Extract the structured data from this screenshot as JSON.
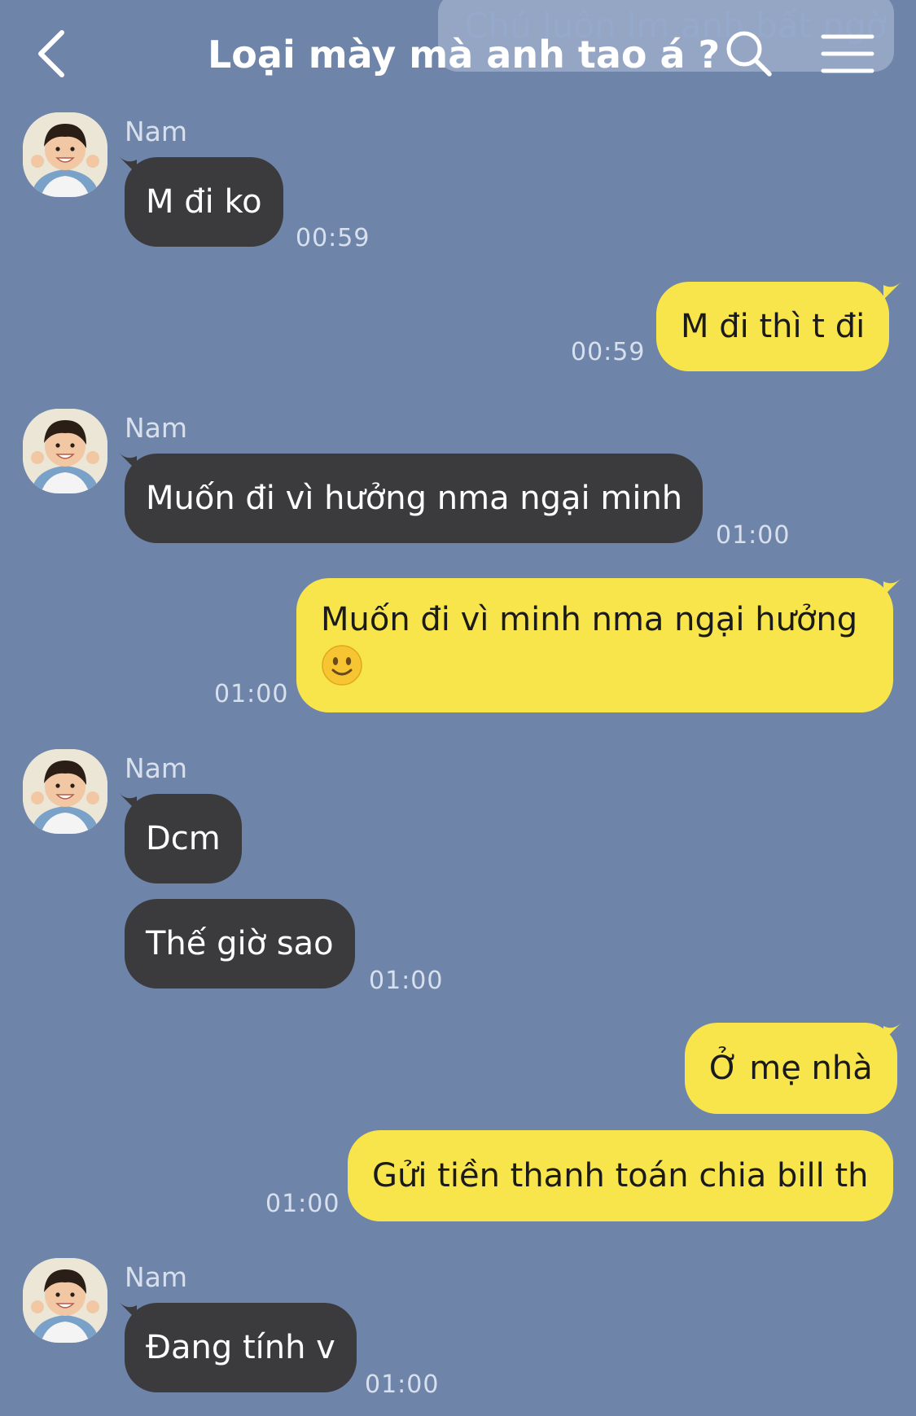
{
  "header": {
    "title": "Loại mày mà anh tao á ?",
    "ghost_text": "Chú luôn lm anh bất ngờ"
  },
  "colors": {
    "background": "#6f84a9",
    "incoming_bubble": "#3b3b3d",
    "outgoing_bubble": "#f8e54b"
  },
  "icons": {
    "back": "chevron-left-icon",
    "search": "search-icon",
    "menu": "hamburger-menu-icon",
    "emoji": "slightly-smiling-face-emoji"
  },
  "messages": [
    {
      "direction": "in",
      "sender": "Nam",
      "text": "M đi ko",
      "time": "00:59"
    },
    {
      "direction": "out",
      "text": "M đi thì t đi",
      "time": "00:59"
    },
    {
      "direction": "in",
      "sender": "Nam",
      "text": "Muốn đi vì hưởng nma ngại minh",
      "time": "01:00"
    },
    {
      "direction": "out",
      "text": "Muốn đi vì minh nma ngại hưởng",
      "emoji": "🙂",
      "time": "01:00"
    },
    {
      "direction": "in",
      "sender": "Nam",
      "text": "Dcm"
    },
    {
      "direction": "in",
      "text": "Thế giờ sao",
      "time": "01:00"
    },
    {
      "direction": "out",
      "text": "Ở mẹ nhà"
    },
    {
      "direction": "out",
      "text": "Gửi tiền thanh toán chia bill th",
      "time": "01:00"
    },
    {
      "direction": "in",
      "sender": "Nam",
      "text": "Đang tính v",
      "time": "01:00"
    }
  ]
}
